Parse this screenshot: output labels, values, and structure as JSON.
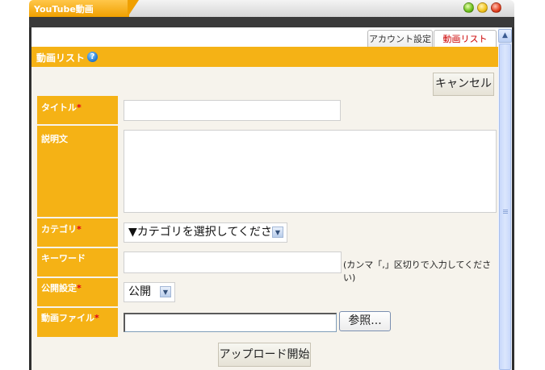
{
  "window": {
    "title": "YouTube動画"
  },
  "tabs": [
    {
      "label": "アカウント設定",
      "active": false
    },
    {
      "label": "動画リスト",
      "active": true
    }
  ],
  "section": {
    "title": "動画リスト"
  },
  "buttons": {
    "cancel": "キャンセル",
    "browse": "参照...",
    "upload": "アップロード開始"
  },
  "form": {
    "title_label": "タイトル",
    "description_label": "説明文",
    "category_label": "カテゴリ",
    "category_value": "▼カテゴリを選択してください",
    "keyword_label": "キーワード",
    "keyword_hint": "(カンマ「,」区切りで入力してください)",
    "visibility_label": "公開設定",
    "visibility_value": "公開",
    "file_label": "動画ファイル",
    "required_mark": "*"
  },
  "colors": {
    "accent": "#f5b215",
    "required": "#e0001b",
    "active_tab_text": "#cc0000"
  }
}
